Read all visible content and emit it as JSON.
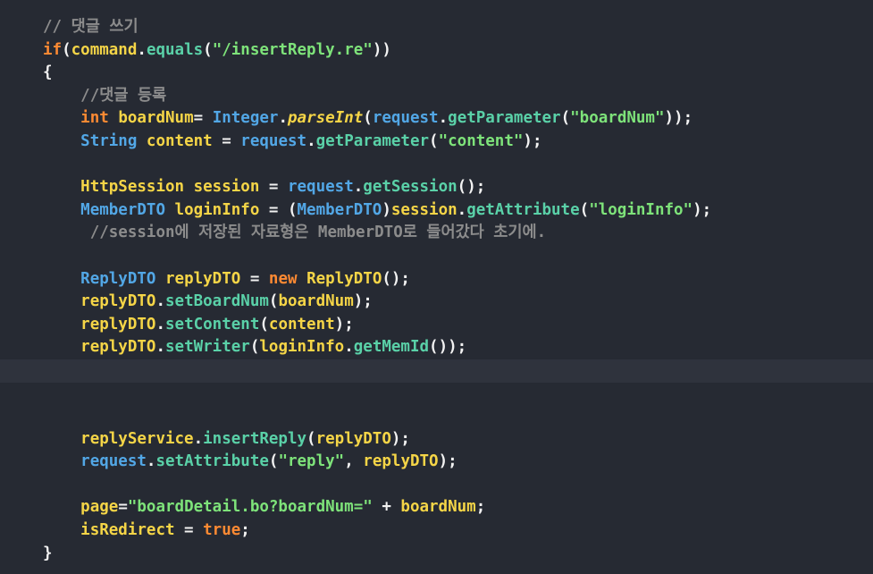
{
  "editor": {
    "language": "java",
    "colors": {
      "background": "#262a33",
      "current_line": "#2f333d",
      "comment": "#8c8c8c",
      "keyword": "#ff8a33",
      "type": "#52a7e6",
      "variable": "#f5d547",
      "method": "#5ad1a8",
      "string": "#7ee37a",
      "punctuation": "#f2f2f2"
    },
    "current_line_index": 15,
    "lines": [
      [
        [
          "comment",
          "// 댓글 쓰기"
        ]
      ],
      [
        [
          "keyword",
          "if"
        ],
        [
          "punct",
          "("
        ],
        [
          "ident",
          "command"
        ],
        [
          "punct",
          "."
        ],
        [
          "method",
          "equals"
        ],
        [
          "punct",
          "("
        ],
        [
          "string",
          "\"/insertReply.re\""
        ],
        [
          "punct",
          "))"
        ]
      ],
      [
        [
          "punct",
          "{"
        ]
      ],
      [
        [
          "plain",
          "    "
        ],
        [
          "comment",
          "//댓글 등록"
        ]
      ],
      [
        [
          "plain",
          "    "
        ],
        [
          "keyword",
          "int"
        ],
        [
          "plain",
          " "
        ],
        [
          "ident",
          "boardNum"
        ],
        [
          "punct",
          "= "
        ],
        [
          "type",
          "Integer"
        ],
        [
          "punct",
          "."
        ],
        [
          "static",
          "parseInt"
        ],
        [
          "punct",
          "("
        ],
        [
          "obj",
          "request"
        ],
        [
          "punct",
          "."
        ],
        [
          "method",
          "getParameter"
        ],
        [
          "punct",
          "("
        ],
        [
          "string",
          "\"boardNum\""
        ],
        [
          "punct",
          "));"
        ]
      ],
      [
        [
          "plain",
          "    "
        ],
        [
          "type",
          "String"
        ],
        [
          "plain",
          " "
        ],
        [
          "ident",
          "content"
        ],
        [
          "punct",
          " = "
        ],
        [
          "obj",
          "request"
        ],
        [
          "punct",
          "."
        ],
        [
          "method",
          "getParameter"
        ],
        [
          "punct",
          "("
        ],
        [
          "string",
          "\"content\""
        ],
        [
          "punct",
          ");"
        ]
      ],
      [
        [
          "plain",
          ""
        ]
      ],
      [
        [
          "plain",
          "    "
        ],
        [
          "ident",
          "HttpSession"
        ],
        [
          "plain",
          " "
        ],
        [
          "ident",
          "session"
        ],
        [
          "punct",
          " = "
        ],
        [
          "obj",
          "request"
        ],
        [
          "punct",
          "."
        ],
        [
          "method",
          "getSession"
        ],
        [
          "punct",
          "();"
        ]
      ],
      [
        [
          "plain",
          "    "
        ],
        [
          "type",
          "MemberDTO"
        ],
        [
          "plain",
          " "
        ],
        [
          "ident",
          "loginInfo"
        ],
        [
          "punct",
          " = ("
        ],
        [
          "type",
          "MemberDTO"
        ],
        [
          "punct",
          ")"
        ],
        [
          "ident",
          "session"
        ],
        [
          "punct",
          "."
        ],
        [
          "method",
          "getAttribute"
        ],
        [
          "punct",
          "("
        ],
        [
          "string",
          "\"loginInfo\""
        ],
        [
          "punct",
          ");"
        ]
      ],
      [
        [
          "plain",
          "     "
        ],
        [
          "comment",
          "//session에 저장된 자료형은 MemberDTO로 들어갔다 초기에."
        ]
      ],
      [
        [
          "plain",
          ""
        ]
      ],
      [
        [
          "plain",
          "    "
        ],
        [
          "type",
          "ReplyDTO"
        ],
        [
          "plain",
          " "
        ],
        [
          "ident",
          "replyDTO"
        ],
        [
          "punct",
          " = "
        ],
        [
          "keyword",
          "new"
        ],
        [
          "plain",
          " "
        ],
        [
          "ident",
          "ReplyDTO"
        ],
        [
          "punct",
          "();"
        ]
      ],
      [
        [
          "plain",
          "    "
        ],
        [
          "ident",
          "replyDTO"
        ],
        [
          "punct",
          "."
        ],
        [
          "method",
          "setBoardNum"
        ],
        [
          "punct",
          "("
        ],
        [
          "ident",
          "boardNum"
        ],
        [
          "punct",
          ");"
        ]
      ],
      [
        [
          "plain",
          "    "
        ],
        [
          "ident",
          "replyDTO"
        ],
        [
          "punct",
          "."
        ],
        [
          "method",
          "setContent"
        ],
        [
          "punct",
          "("
        ],
        [
          "ident",
          "content"
        ],
        [
          "punct",
          ");"
        ]
      ],
      [
        [
          "plain",
          "    "
        ],
        [
          "ident",
          "replyDTO"
        ],
        [
          "punct",
          "."
        ],
        [
          "method",
          "setWriter"
        ],
        [
          "punct",
          "("
        ],
        [
          "ident",
          "loginInfo"
        ],
        [
          "punct",
          "."
        ],
        [
          "method",
          "getMemId"
        ],
        [
          "punct",
          "());"
        ]
      ],
      [
        [
          "plain",
          ""
        ]
      ],
      [
        [
          "plain",
          ""
        ]
      ],
      [
        [
          "plain",
          ""
        ]
      ],
      [
        [
          "plain",
          "    "
        ],
        [
          "ident",
          "replyService"
        ],
        [
          "punct",
          "."
        ],
        [
          "method",
          "insertReply"
        ],
        [
          "punct",
          "("
        ],
        [
          "ident",
          "replyDTO"
        ],
        [
          "punct",
          ");"
        ]
      ],
      [
        [
          "plain",
          "    "
        ],
        [
          "obj",
          "request"
        ],
        [
          "punct",
          "."
        ],
        [
          "method",
          "setAttribute"
        ],
        [
          "punct",
          "("
        ],
        [
          "string",
          "\"reply\""
        ],
        [
          "punct",
          ", "
        ],
        [
          "ident",
          "replyDTO"
        ],
        [
          "punct",
          ");"
        ]
      ],
      [
        [
          "plain",
          ""
        ]
      ],
      [
        [
          "plain",
          "    "
        ],
        [
          "ident",
          "page"
        ],
        [
          "punct",
          "="
        ],
        [
          "string",
          "\"boardDetail.bo?boardNum=\""
        ],
        [
          "punct",
          " + "
        ],
        [
          "ident",
          "boardNum"
        ],
        [
          "punct",
          ";"
        ]
      ],
      [
        [
          "plain",
          "    "
        ],
        [
          "ident",
          "isRedirect"
        ],
        [
          "punct",
          " = "
        ],
        [
          "keyword",
          "true"
        ],
        [
          "punct",
          ";"
        ]
      ],
      [
        [
          "punct",
          "}"
        ]
      ]
    ]
  }
}
